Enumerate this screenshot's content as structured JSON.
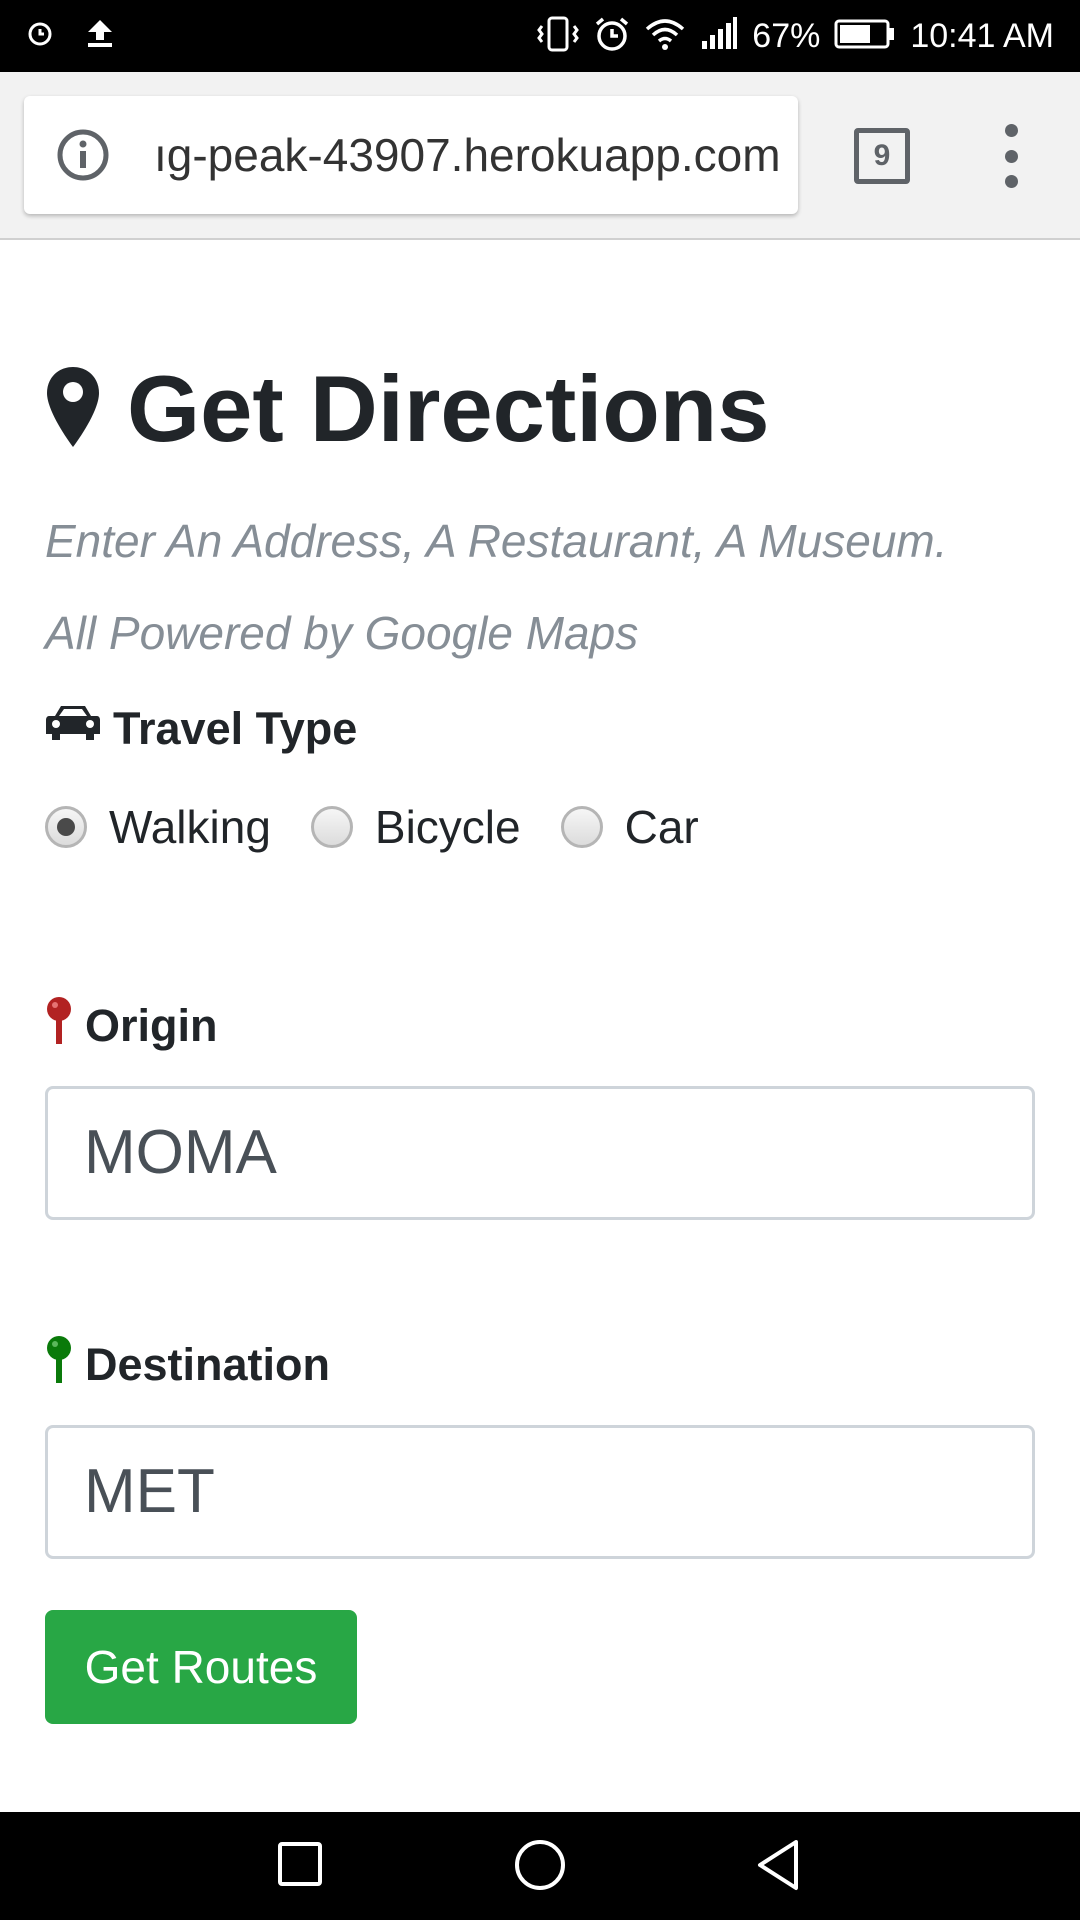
{
  "status_bar": {
    "battery_percent": "67%",
    "time": "10:41 AM",
    "icons_left": [
      "alarm-icon",
      "upload-icon"
    ],
    "icons_right": [
      "vibrate-icon",
      "alarm-icon",
      "wifi-icon",
      "signal-icon",
      "battery-icon"
    ]
  },
  "browser": {
    "url": "ıg-peak-43907.herokuapp.com",
    "tab_count": "9"
  },
  "page": {
    "title": "Get Directions",
    "subtitle_1": "Enter An Address, A Restaurant, A Museum.",
    "subtitle_2": "All Powered by Google Maps",
    "travel_type_label": "Travel Type",
    "travel_options": [
      {
        "label": "Walking",
        "checked": true
      },
      {
        "label": "Bicycle",
        "checked": false
      },
      {
        "label": "Car",
        "checked": false
      }
    ],
    "origin_label": "Origin",
    "origin_value": "MOMA",
    "destination_label": "Destination",
    "destination_value": "MET",
    "submit_label": "Get Routes"
  },
  "colors": {
    "button": "#28a745",
    "origin_pin": "#b22222",
    "destination_pin": "#0a7a0a",
    "heading": "#212529",
    "muted": "#868e96"
  }
}
